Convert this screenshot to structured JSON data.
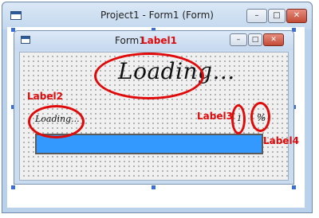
{
  "window": {
    "title": "Project1 - Form1 (Form)",
    "buttons": {
      "minimize": "–",
      "maximize": "□",
      "close": "✕"
    }
  },
  "form": {
    "title": "Form1",
    "buttons": {
      "minimize": "–",
      "maximize": "□",
      "close": "✕"
    }
  },
  "controls": {
    "label1_text": "Loading...",
    "label2_text": "Loading...",
    "label3_text": "1",
    "label4_text": "%",
    "progress": {
      "value": 1.0,
      "fill_color": "#3399ff"
    }
  },
  "annotations": {
    "label1": "Label1",
    "label2": "Label2",
    "label3": "Label3",
    "label4": "Label4",
    "color": "#e00a0a"
  },
  "icons": [
    "form-icon",
    "minimize-icon",
    "maximize-icon",
    "close-icon"
  ]
}
